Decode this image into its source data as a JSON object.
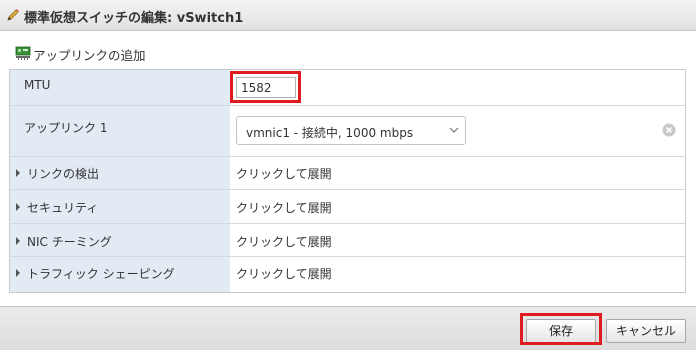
{
  "dialog": {
    "title": "標準仮想スイッチの編集: vSwitch1",
    "title_icon": "pencil-icon"
  },
  "section": {
    "label": "アップリンクの追加",
    "icon": "network-adapter-icon"
  },
  "form": {
    "mtu": {
      "label": "MTU",
      "value": "1582"
    },
    "uplink1": {
      "label": "アップリンク 1",
      "selected": "vmnic1 - 接続中, 1000 mbps"
    },
    "link_discovery": {
      "label": "リンクの検出",
      "value": "クリックして展開"
    },
    "security": {
      "label": "セキュリティ",
      "value": "クリックして展開"
    },
    "nic_teaming": {
      "label": "NIC チーミング",
      "value": "クリックして展開"
    },
    "traffic_shaping": {
      "label": "トラフィック シェーピング",
      "value": "クリックして展開"
    }
  },
  "footer": {
    "save_label": "保存",
    "cancel_label": "キャンセル"
  },
  "colors": {
    "highlight": "#e01b22",
    "label_column": "#e2eaf3"
  }
}
